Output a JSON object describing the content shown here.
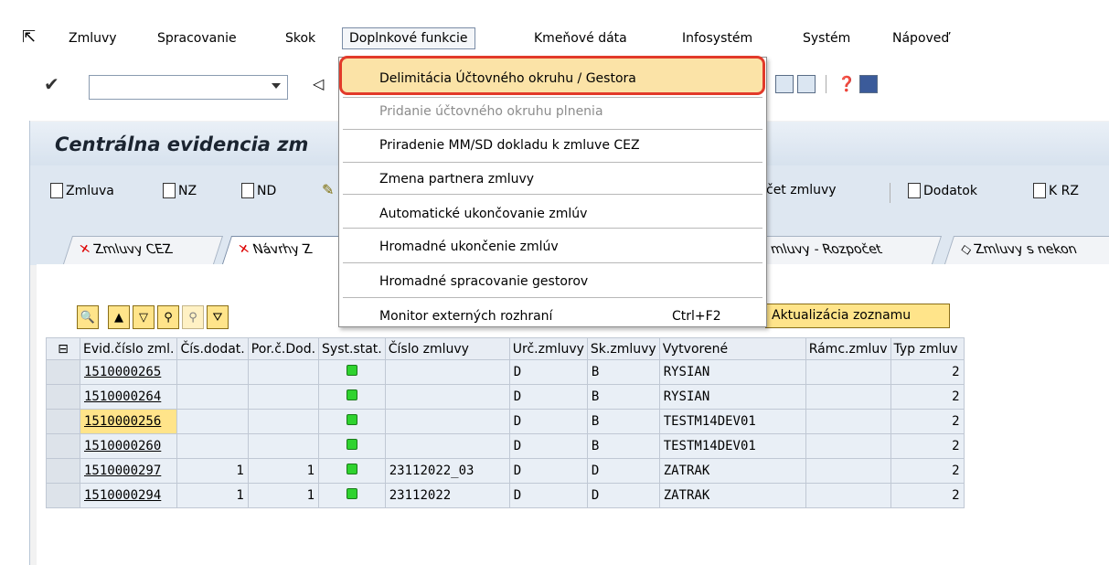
{
  "menubar": {
    "items": [
      "Zmluvy",
      "Spracovanie",
      "Skok",
      "Doplnkové funkcie",
      "Kmeňové dáta",
      "Infosystém",
      "Systém",
      "Nápoveď"
    ]
  },
  "toolbar": {
    "command_value": ""
  },
  "title": "Centrálna evidencia zm",
  "app_toolbar": {
    "buttons": [
      "Zmluva",
      "NZ",
      "ND",
      "čet zmluvy",
      "Dodatok",
      "K RZ"
    ]
  },
  "tabs": [
    "Zmluvy CEZ",
    "Návrhy Z",
    "mluvy - Rozpočet",
    "Zmluvy s nekon"
  ],
  "alv": {
    "refresh_label": "Aktualizácia zoznamu"
  },
  "dropdown": {
    "items": [
      {
        "label": "Delimitácia Účtovného okruhu / Gestora",
        "enabled": true,
        "highlighted": true
      },
      {
        "label": "Pridanie účtovného okruhu plnenia",
        "enabled": false
      },
      {
        "label": "Priradenie MM/SD dokladu k zmluve CEZ",
        "enabled": true
      },
      {
        "label": "Zmena partnera zmluvy",
        "enabled": true
      },
      {
        "label": "Automatické ukončovanie zmlúv",
        "enabled": true
      },
      {
        "label": "Hromadné ukončenie zmlúv",
        "enabled": true
      },
      {
        "label": "Hromadné spracovanie gestorov",
        "enabled": true
      },
      {
        "label": "Monitor externých rozhraní",
        "enabled": true,
        "shortcut": "Ctrl+F2"
      }
    ]
  },
  "table": {
    "columns": [
      "Evid.číslo zml.",
      "Čís.dodat.",
      "Por.č.Dod.",
      "Syst.stat.",
      "Číslo zmluvy",
      "Urč.zmluvy",
      "Sk.zmluvy",
      "Vytvorené",
      "Rámc.zmluv",
      "Typ zmluv"
    ],
    "rows": [
      {
        "evid": "1510000265",
        "dodat": "",
        "por": "",
        "cislo": "",
        "urc": "D",
        "sk": "B",
        "vytv": "RYSIAN",
        "ramc": "",
        "typ": "2"
      },
      {
        "evid": "1510000264",
        "dodat": "",
        "por": "",
        "cislo": "",
        "urc": "D",
        "sk": "B",
        "vytv": "RYSIAN",
        "ramc": "",
        "typ": "2"
      },
      {
        "evid": "1510000256",
        "dodat": "",
        "por": "",
        "cislo": "",
        "urc": "D",
        "sk": "B",
        "vytv": "TESTM14DEV01",
        "ramc": "",
        "typ": "2"
      },
      {
        "evid": "1510000260",
        "dodat": "",
        "por": "",
        "cislo": "",
        "urc": "D",
        "sk": "B",
        "vytv": "TESTM14DEV01",
        "ramc": "",
        "typ": "2"
      },
      {
        "evid": "1510000297",
        "dodat": "1",
        "por": "1",
        "cislo": "23112022_03",
        "urc": "D",
        "sk": "D",
        "vytv": "ZATRAK",
        "ramc": "",
        "typ": "2"
      },
      {
        "evid": "1510000294",
        "dodat": "1",
        "por": "1",
        "cislo": "23112022",
        "urc": "D",
        "sk": "D",
        "vytv": "ZATRAK",
        "ramc": "",
        "typ": "2"
      }
    ]
  },
  "colors": {
    "status_green": "#2fd32f",
    "highlight_yellow": "#ffe48a",
    "menu_highlight_border": "#e23a2a"
  }
}
